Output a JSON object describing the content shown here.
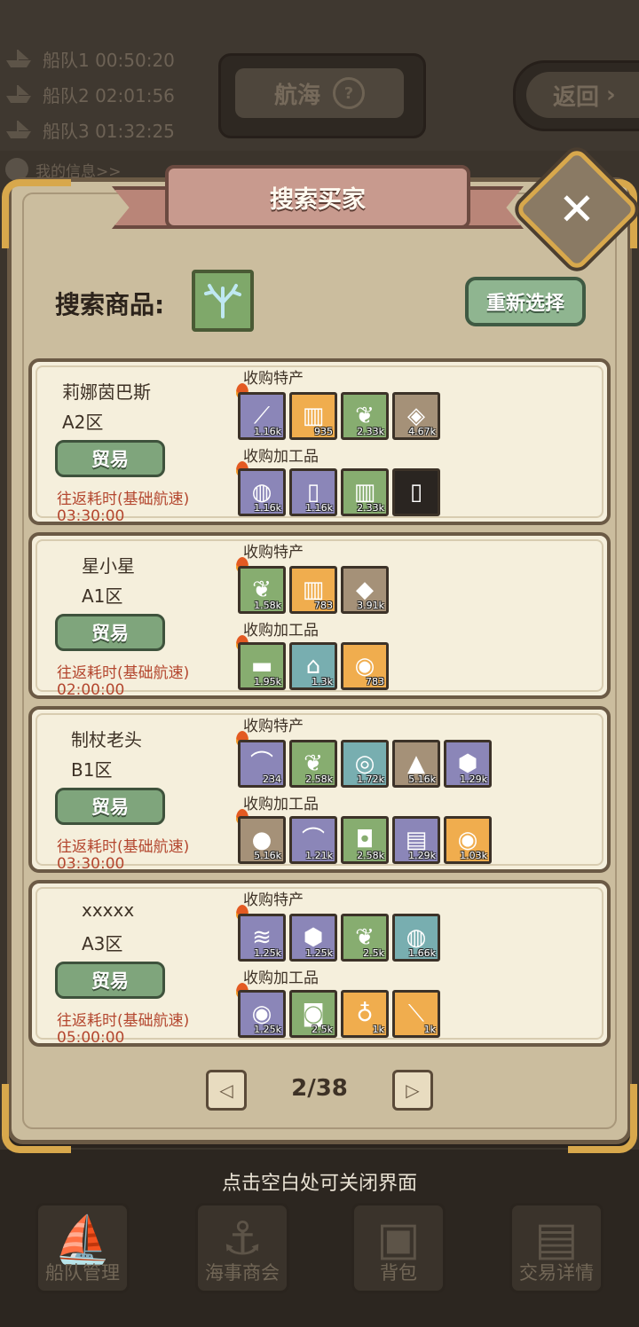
{
  "background": {
    "fleets": [
      "船队1 00:50:20",
      "船队2 02:01:56",
      "船队3 01:32:25"
    ],
    "nav_title": "航海",
    "nav_help": "?",
    "back_label": "返回",
    "back_arrow": "›",
    "my_info": "我的信息>>",
    "close_hint": "点击空白处可关闭界面",
    "bottom_nav": [
      {
        "label": "船队管理",
        "icon": "ship-icon"
      },
      {
        "label": "海事商会",
        "icon": "anchor-icon"
      },
      {
        "label": "背包",
        "icon": "backpack-icon"
      },
      {
        "label": "交易详情",
        "icon": "scroll-icon"
      }
    ]
  },
  "dialog": {
    "title": "搜索买家",
    "close": "✕",
    "search_label": "搜索商品:",
    "reselect_label": "重新选择",
    "section_specialty": "收购特产",
    "section_processed": "收购加工品",
    "trade_label": "贸易",
    "roundtrip_label": "往返耗时(基础航速)",
    "buyers": [
      {
        "name": "莉娜茵巴斯",
        "zone": "A2区",
        "time": "03:30:00",
        "specialty": [
          {
            "color": "purple",
            "icon": "staff-icon",
            "qty": "1.16k"
          },
          {
            "color": "orange",
            "icon": "jar-icon",
            "qty": "935"
          },
          {
            "color": "green",
            "icon": "coral-icon",
            "qty": "2.33k"
          },
          {
            "color": "brown",
            "icon": "cloth-icon",
            "qty": "4.67k"
          }
        ],
        "processed": [
          {
            "color": "purple",
            "icon": "pot-icon",
            "qty": "1.16k"
          },
          {
            "color": "purple",
            "icon": "bottle-icon",
            "qty": "1.16k"
          },
          {
            "color": "green",
            "icon": "jar-icon",
            "qty": "2.33k"
          },
          {
            "color": "dark",
            "icon": "bottle-icon",
            "qty": ""
          }
        ]
      },
      {
        "name": "星小星",
        "zone": "A1区",
        "time": "02:00:00",
        "specialty": [
          {
            "color": "green",
            "icon": "coral-icon",
            "qty": "1.58k"
          },
          {
            "color": "orange",
            "icon": "jar-icon",
            "qty": "783"
          },
          {
            "color": "brown",
            "icon": "crystal-icon",
            "qty": "3.91k"
          }
        ],
        "processed": [
          {
            "color": "green",
            "icon": "ingot-icon",
            "qty": "1.95k"
          },
          {
            "color": "teal",
            "icon": "sweater-icon",
            "qty": "1.3k"
          },
          {
            "color": "orange",
            "icon": "perfume-icon",
            "qty": "783"
          }
        ]
      },
      {
        "name": "制杖老头",
        "zone": "B1区",
        "time": "03:30:00",
        "specialty": [
          {
            "color": "purple",
            "icon": "mushroom-icon",
            "qty": "234"
          },
          {
            "color": "green",
            "icon": "coral-icon",
            "qty": "2.58k"
          },
          {
            "color": "teal",
            "icon": "shell-icon",
            "qty": "1.72k"
          },
          {
            "color": "brown",
            "icon": "powder-icon",
            "qty": "5.16k"
          },
          {
            "color": "purple",
            "icon": "emerald-icon",
            "qty": "1.29k"
          }
        ],
        "processed": [
          {
            "color": "brown",
            "icon": "cookie-icon",
            "qty": "5.16k"
          },
          {
            "color": "purple",
            "icon": "mushroom-icon",
            "qty": "1.21k"
          },
          {
            "color": "green",
            "icon": "vase-icon",
            "qty": "2.58k"
          },
          {
            "color": "purple",
            "icon": "scroll-icon",
            "qty": "1.29k"
          },
          {
            "color": "orange",
            "icon": "perfume-icon",
            "qty": "1.03k"
          }
        ]
      },
      {
        "name": "xxxxx",
        "zone": "A3区",
        "time": "05:00:00",
        "specialty": [
          {
            "color": "purple",
            "icon": "feather-icon",
            "qty": "1.25k"
          },
          {
            "color": "purple",
            "icon": "emerald-icon",
            "qty": "1.25k"
          },
          {
            "color": "green",
            "icon": "coral-icon",
            "qty": "2.5k"
          },
          {
            "color": "teal",
            "icon": "pot-icon",
            "qty": "1.66k"
          }
        ],
        "processed": [
          {
            "color": "purple",
            "icon": "perfume-icon",
            "qty": "1.25k"
          },
          {
            "color": "green",
            "icon": "sack-icon",
            "qty": "2.5k"
          },
          {
            "color": "orange",
            "icon": "potion-icon",
            "qty": "1k"
          },
          {
            "color": "orange",
            "icon": "knife-icon",
            "qty": "1k"
          }
        ]
      }
    ],
    "pagination": {
      "text": "2/38",
      "prev": "◁",
      "next": "▷"
    }
  }
}
